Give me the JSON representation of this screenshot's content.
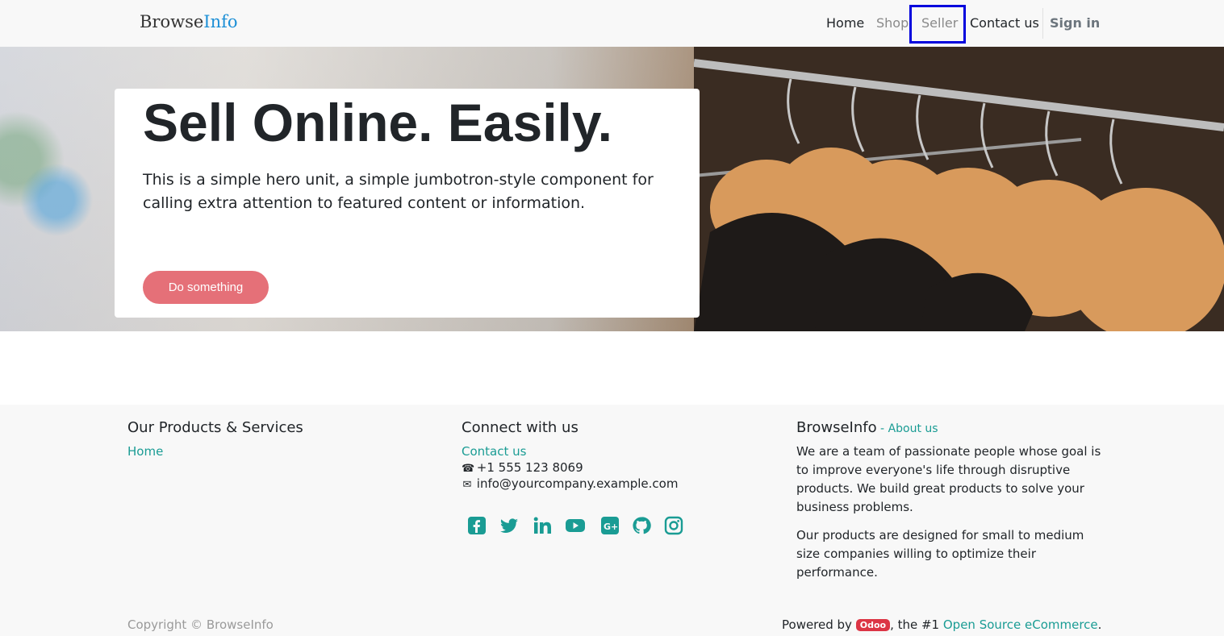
{
  "header": {
    "brand_part1": "Browse",
    "brand_part2": "Info",
    "nav": {
      "home": "Home",
      "shop": "Shop",
      "seller": "Seller",
      "contact": "Contact us",
      "signin": "Sign in"
    }
  },
  "hero": {
    "title": "Sell Online. Easily.",
    "text": "This is a simple hero unit, a simple jumbotron-style component for calling extra attention to featured content or information.",
    "button_label": "Do something"
  },
  "footer": {
    "col1": {
      "heading": "Our Products & Services",
      "link_home": "Home"
    },
    "col2": {
      "heading": "Connect with us",
      "link_contact": "Contact us",
      "phone": "+1 555 123 8069",
      "email": "info@yourcompany.example.com",
      "social_icons": [
        "facebook-icon",
        "twitter-icon",
        "linkedin-icon",
        "youtube-icon",
        "google-plus-icon",
        "github-icon",
        "instagram-icon"
      ]
    },
    "col3": {
      "heading": "BrowseInfo",
      "dash": " - ",
      "about_link": "About us",
      "para1": "We are a team of passionate people whose goal is to improve everyone's life through disruptive products. We build great products to solve your business problems.",
      "para2": "Our products are designed for small to medium size companies willing to optimize their performance."
    },
    "copyright": "Copyright © BrowseInfo",
    "powered": {
      "prefix": "Powered by ",
      "badge": "Odoo",
      "middle": ", the #1 ",
      "link": "Open Source eCommerce",
      "suffix": "."
    }
  },
  "colors": {
    "accent_teal": "#1a9c94",
    "brand_blue": "#1c8fd6",
    "button_pink": "#e57078",
    "highlight_box": "#0000dd"
  }
}
